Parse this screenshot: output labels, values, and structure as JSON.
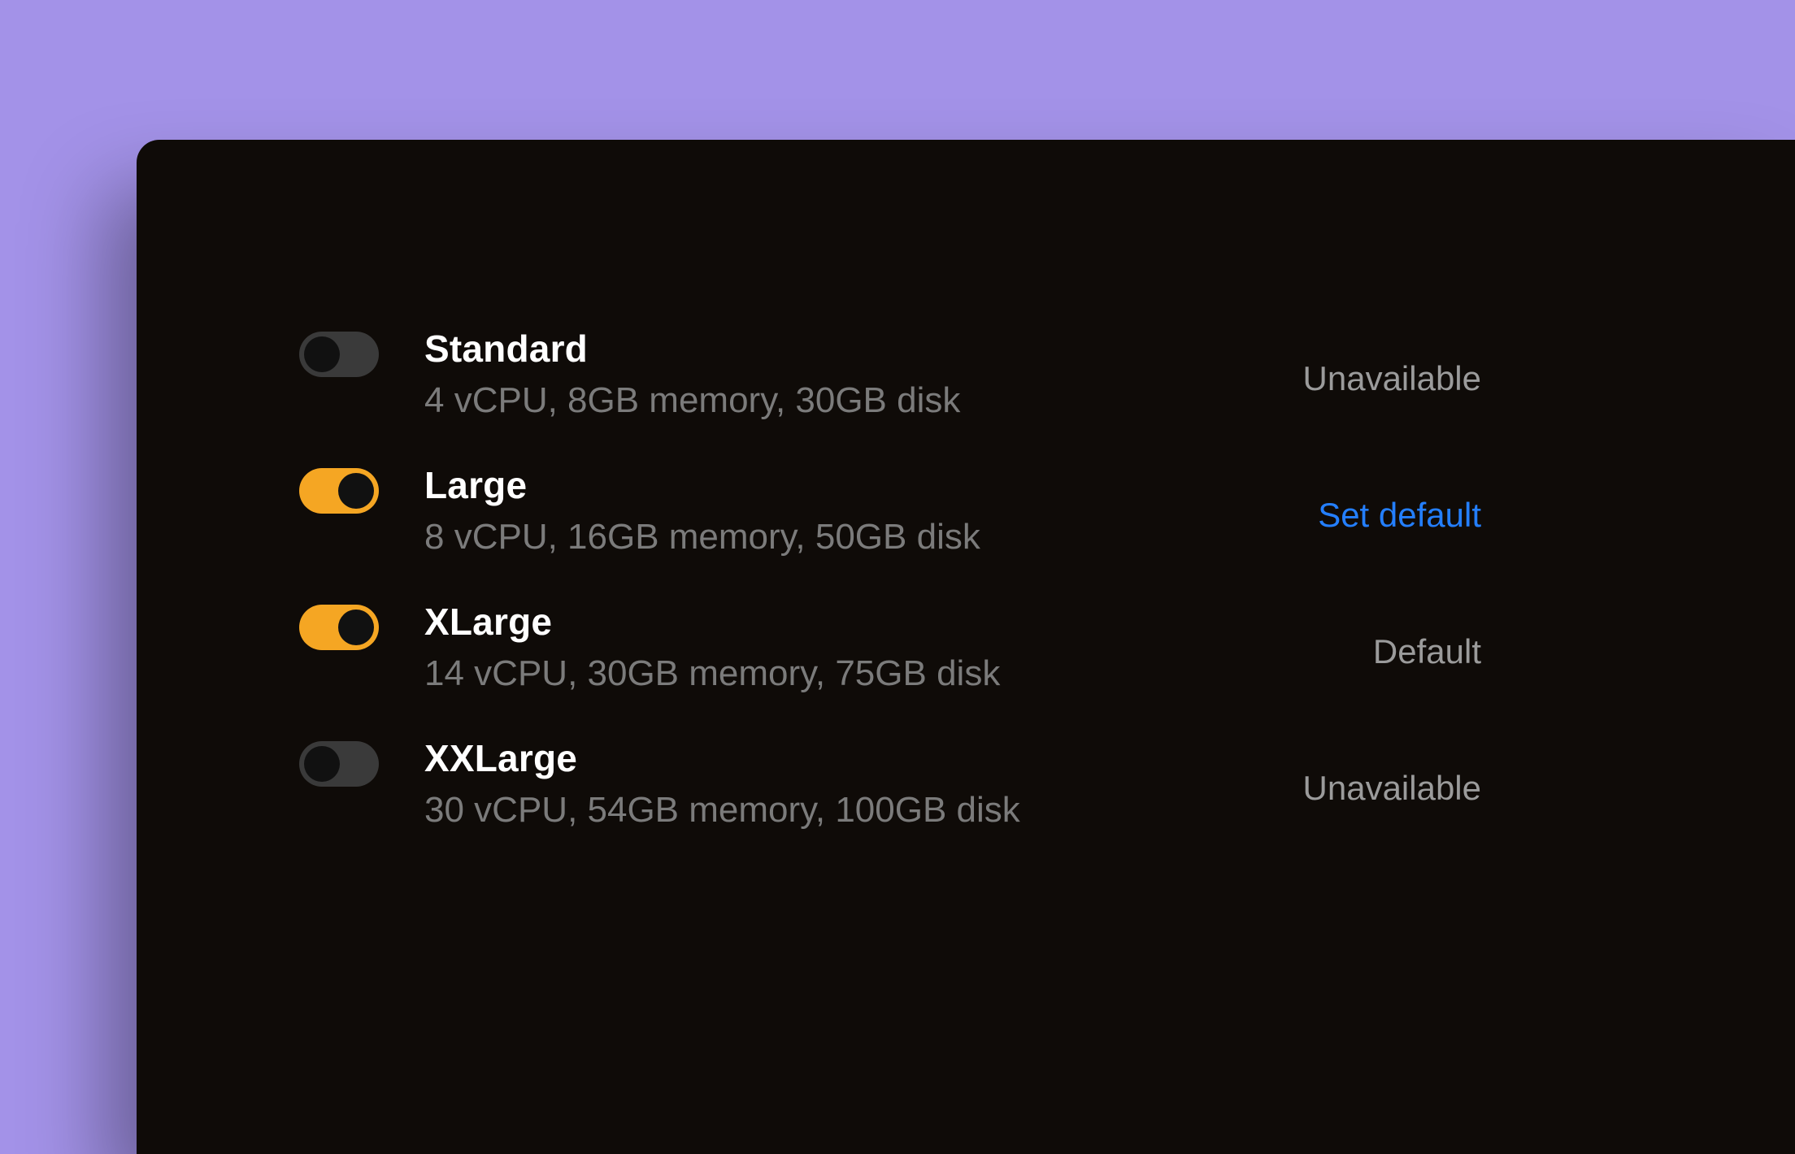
{
  "colors": {
    "accent": "#f5a623",
    "link": "#247fff",
    "bg": "#a392e8",
    "panel": "#0f0b08"
  },
  "options": [
    {
      "name": "Standard",
      "specs": "4 vCPU, 8GB memory, 30GB disk",
      "on": false,
      "status": "Unavailable",
      "status_kind": "muted"
    },
    {
      "name": "Large",
      "specs": "8 vCPU, 16GB memory, 50GB disk",
      "on": true,
      "status": "Set default",
      "status_kind": "link"
    },
    {
      "name": "XLarge",
      "specs": "14 vCPU, 30GB memory, 75GB disk",
      "on": true,
      "status": "Default",
      "status_kind": "muted"
    },
    {
      "name": "XXLarge",
      "specs": "30 vCPU, 54GB memory, 100GB disk",
      "on": false,
      "status": "Unavailable",
      "status_kind": "muted"
    }
  ]
}
